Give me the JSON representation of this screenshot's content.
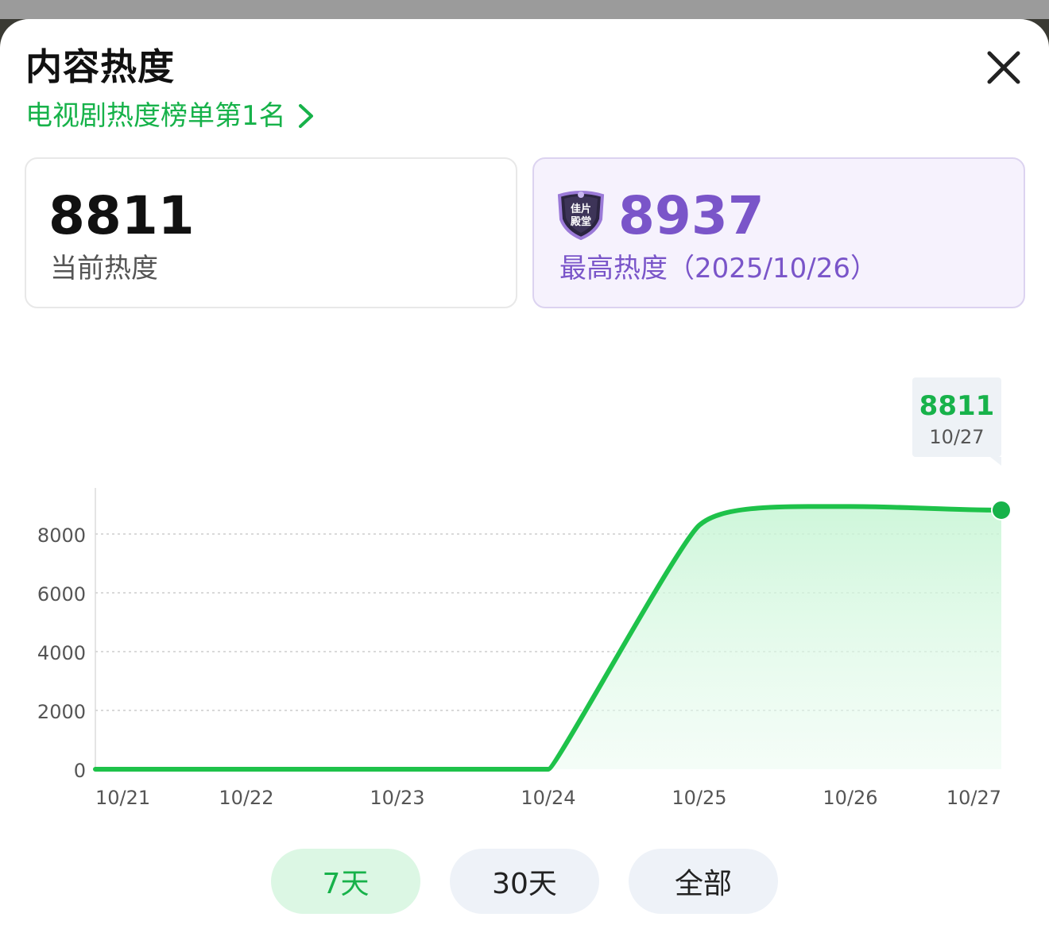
{
  "header": {
    "title": "内容热度",
    "rank_text": "电视剧热度榜单第1名"
  },
  "cards": {
    "current": {
      "value": "8811",
      "label": "当前热度"
    },
    "peak": {
      "value": "8937",
      "label": "最高热度（2025/10/26）",
      "badge_text": "佳片殿堂"
    }
  },
  "tooltip": {
    "value": "8811",
    "date": "10/27"
  },
  "ranges": {
    "seven": "7天",
    "thirty": "30天",
    "all": "全部",
    "selected": "7天"
  },
  "colors": {
    "accent": "#17b24a",
    "line": "#1ec24a",
    "peak": "#7a55c9"
  },
  "chart_data": {
    "type": "area",
    "x": [
      "10/21",
      "10/22",
      "10/23",
      "10/24",
      "10/25",
      "10/26",
      "10/27"
    ],
    "series": [
      {
        "values": [
          0,
          0,
          0,
          0,
          8300,
          8937,
          8811
        ]
      }
    ],
    "yticks": [
      0,
      2000,
      4000,
      6000,
      8000
    ],
    "ylim": [
      0,
      9600
    ],
    "grid": true,
    "highlight_index": 6
  }
}
